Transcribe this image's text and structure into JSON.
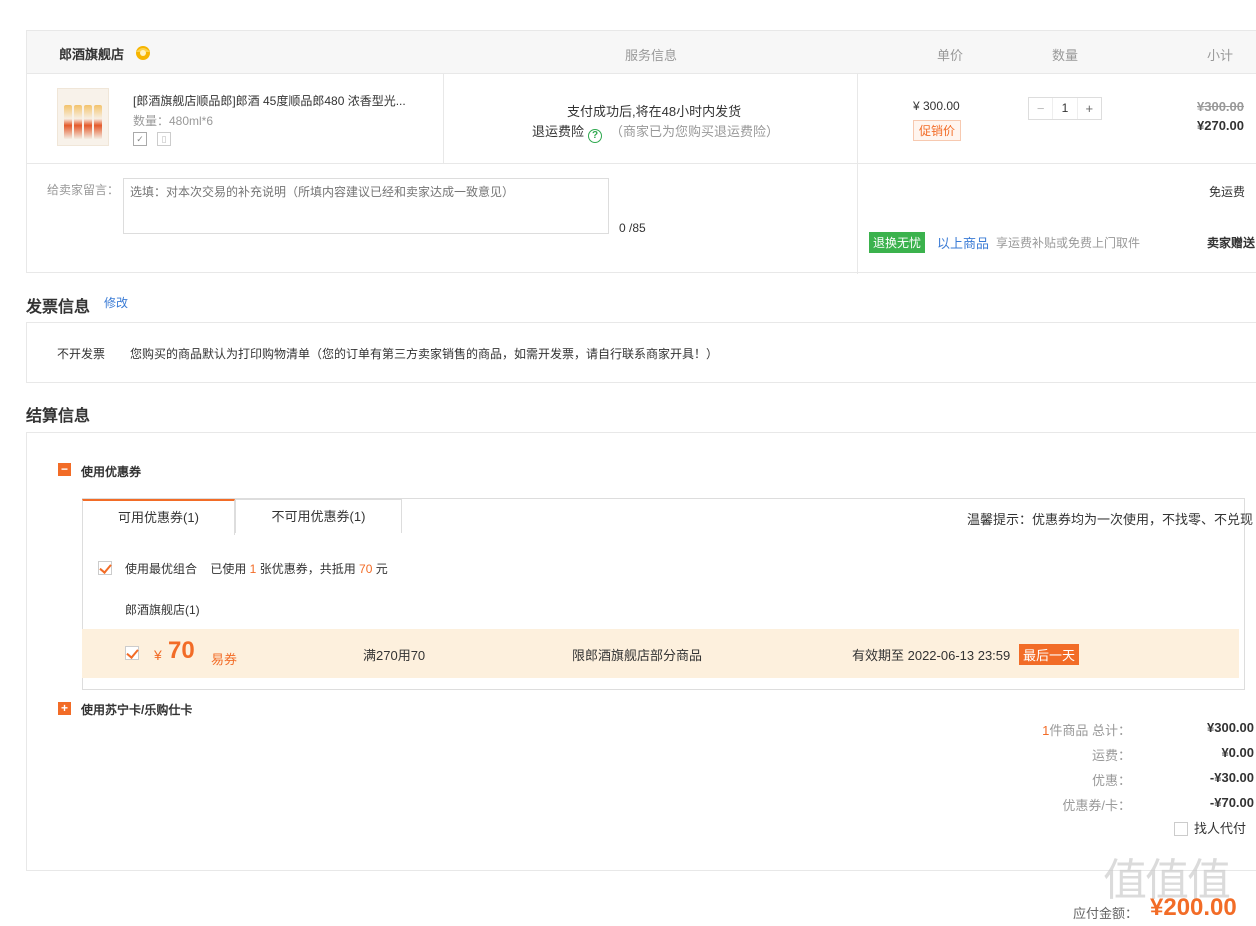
{
  "order": {
    "shop_name": "郎酒旗舰店",
    "headers": {
      "service": "服务信息",
      "unit_price": "单价",
      "quantity": "数量",
      "subtotal": "小计"
    },
    "item": {
      "title": "[郎酒旗舰店顺品郎]郎酒 45度顺品郎480 浓香型光...",
      "spec": "数量：480ml*6",
      "service_line1": "支付成功后,将在48小时内发货",
      "insurance_label": "退运费险",
      "insurance_note": "（商家已为您购买退运费险）",
      "unit_price": "¥ 300.00",
      "promo_tag": "促销价",
      "quantity": "1",
      "old_price": "¥300.00",
      "new_price": "¥270.00"
    },
    "message_label": "给卖家留言：",
    "message_placeholder": "选填：对本次交易的补充说明（所填内容建议已经和卖家达成一致意见）",
    "message_count": "0 /85",
    "shipping": "免运费",
    "return_tag": "退换无忧",
    "return_link": "以上商品",
    "return_note": "享运费补贴或免费上门取件",
    "gift": "卖家赠送"
  },
  "invoice": {
    "title": "发票信息",
    "edit": "修改",
    "type": "不开发票",
    "desc": "您购买的商品默认为打印购物清单（您的订单有第三方卖家销售的商品，如需开发票，请自行联系商家开具！）"
  },
  "settle": {
    "title": "结算信息",
    "coupon_section": "使用优惠券",
    "tab_available": "可用优惠券(1)",
    "tab_unavailable": "不可用优惠券(1)",
    "tip": "温馨提示：优惠券均为一次使用，不找零、不兑现",
    "combo_prefix": "使用最优组合    已使用 ",
    "combo_count": "1",
    "combo_mid": " 张优惠券，共抵用 ",
    "combo_amount": "70",
    "combo_suffix": " 元",
    "shop_sub": "郎酒旗舰店(1)",
    "coupon": {
      "currency": "¥",
      "amount": "70",
      "type": "易券",
      "rule": "满270用70",
      "scope": "限郎酒旗舰店部分商品",
      "valid": "有效期至 2022-06-13 23:59",
      "last_day": "最后一天"
    },
    "card_section": "使用苏宁卡/乐购仕卡",
    "summary": {
      "count": "1",
      "total_label": "件商品 总计：",
      "total": "¥300.00",
      "freight_label": "运费：",
      "freight": "¥0.00",
      "discount_label": "优惠：",
      "discount": "-¥30.00",
      "coupon_label": "优惠券/卡：",
      "coupon": "-¥70.00",
      "proxy": "找人代付"
    },
    "pay_label": "应付金额：",
    "pay_amount": "¥200.00"
  },
  "watermark": "值值值",
  "colors": {
    "accent": "#f26c27",
    "green": "#3bb24d",
    "link": "#3a7bd5"
  }
}
